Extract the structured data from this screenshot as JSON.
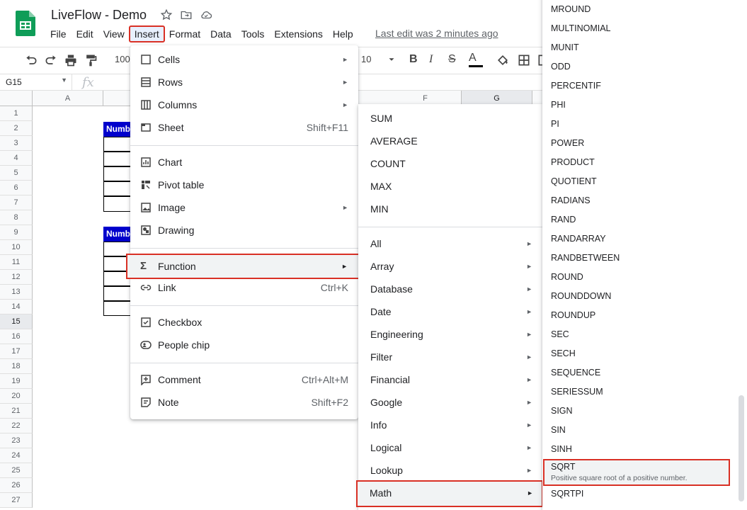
{
  "doc": {
    "title": "LiveFlow - Demo",
    "last_edit": "Last edit was 2 minutes ago"
  },
  "menubar": [
    "File",
    "Edit",
    "View",
    "Insert",
    "Format",
    "Data",
    "Tools",
    "Extensions",
    "Help"
  ],
  "toolbar": {
    "zoom": "100%",
    "font_size": "10"
  },
  "namebox": "G15",
  "fx": "fx",
  "columns": [
    "A",
    "F",
    "G"
  ],
  "rows": [
    "1",
    "2",
    "3",
    "4",
    "5",
    "6",
    "7",
    "8",
    "9",
    "10",
    "11",
    "12",
    "13",
    "14",
    "15",
    "16",
    "17",
    "18",
    "19",
    "20",
    "21",
    "22",
    "23",
    "24",
    "25",
    "26",
    "27"
  ],
  "table_header": "Number",
  "insert_menu": [
    {
      "label": "Cells",
      "icon": "cells-icon",
      "submenu": true
    },
    {
      "label": "Rows",
      "icon": "rows-icon",
      "submenu": true
    },
    {
      "label": "Columns",
      "icon": "columns-icon",
      "submenu": true
    },
    {
      "label": "Sheet",
      "icon": "sheet-icon",
      "shortcut": "Shift+F11"
    },
    {
      "label": "Chart",
      "icon": "chart-icon"
    },
    {
      "label": "Pivot table",
      "icon": "pivot-table-icon"
    },
    {
      "label": "Image",
      "icon": "image-icon",
      "submenu": true
    },
    {
      "label": "Drawing",
      "icon": "drawing-icon"
    },
    {
      "label": "Function",
      "icon": "sigma-icon",
      "submenu": true,
      "highlighted": true
    },
    {
      "label": "Link",
      "icon": "link-icon",
      "shortcut": "Ctrl+K"
    },
    {
      "label": "Checkbox",
      "icon": "checkbox-icon"
    },
    {
      "label": "People chip",
      "icon": "people-chip-icon"
    },
    {
      "label": "Comment",
      "icon": "comment-icon",
      "shortcut": "Ctrl+Alt+M"
    },
    {
      "label": "Note",
      "icon": "note-icon",
      "shortcut": "Shift+F2"
    }
  ],
  "function_menu": {
    "quick": [
      "SUM",
      "AVERAGE",
      "COUNT",
      "MAX",
      "MIN"
    ],
    "categories": [
      "All",
      "Array",
      "Database",
      "Date",
      "Engineering",
      "Filter",
      "Financial",
      "Google",
      "Info",
      "Logical",
      "Lookup",
      "Math"
    ],
    "highlighted": "Math"
  },
  "math_menu": {
    "items": [
      "MROUND",
      "MULTINOMIAL",
      "MUNIT",
      "ODD",
      "PERCENTIF",
      "PHI",
      "PI",
      "POWER",
      "PRODUCT",
      "QUOTIENT",
      "RADIANS",
      "RAND",
      "RANDARRAY",
      "RANDBETWEEN",
      "ROUND",
      "ROUNDDOWN",
      "ROUNDUP",
      "SEC",
      "SECH",
      "SEQUENCE",
      "SERIESSUM",
      "SIGN",
      "SIN",
      "SINH"
    ],
    "highlighted": {
      "name": "SQRT",
      "description": "Positive square root of a positive number."
    },
    "after": "SQRTPI"
  },
  "colors": {
    "highlight_border": "#d93025",
    "table_header_bg": "#0000cc",
    "menu_hover": "#f1f3f4"
  }
}
